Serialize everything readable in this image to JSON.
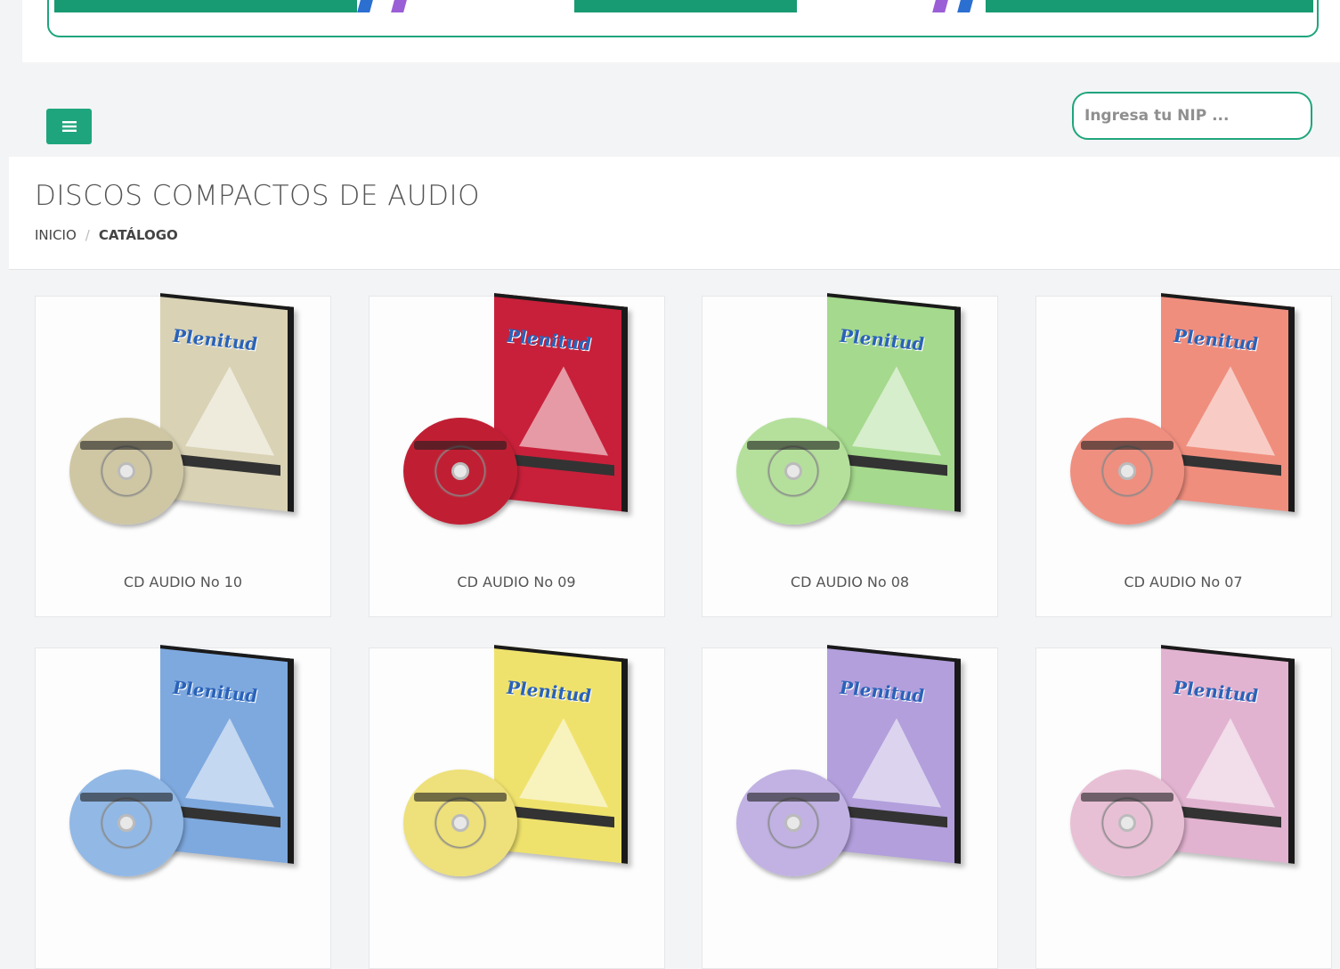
{
  "search": {
    "placeholder": "Ingresa tu NIP ..."
  },
  "menu_icon": "hamburger-icon",
  "page_title": "DISCOS COMPACTOS DE AUDIO",
  "breadcrumb": {
    "home": "INICIO",
    "separator": "/",
    "current": "CATÁLOGO"
  },
  "colors": {
    "accent": "#1fa57d",
    "background": "#f3f4f5"
  },
  "product_brand": "Plenitud",
  "products": [
    {
      "name": "CD AUDIO No 10",
      "color": "#d9d2b4",
      "disc": "#cfc7a3"
    },
    {
      "name": "CD AUDIO No 09",
      "color": "#c8203a",
      "disc": "#c01f33"
    },
    {
      "name": "CD AUDIO No 08",
      "color": "#a5d98d",
      "disc": "#b5e09c"
    },
    {
      "name": "CD AUDIO No 07",
      "color": "#f08e7e",
      "disc": "#ef8f80"
    },
    {
      "name": "",
      "color": "#7ea9df",
      "disc": "#92b8e5"
    },
    {
      "name": "",
      "color": "#efe26c",
      "disc": "#eee07a"
    },
    {
      "name": "",
      "color": "#b29fdc",
      "disc": "#c1b2e3"
    },
    {
      "name": "",
      "color": "#e2b3d0",
      "disc": "#e8c0d6"
    }
  ]
}
